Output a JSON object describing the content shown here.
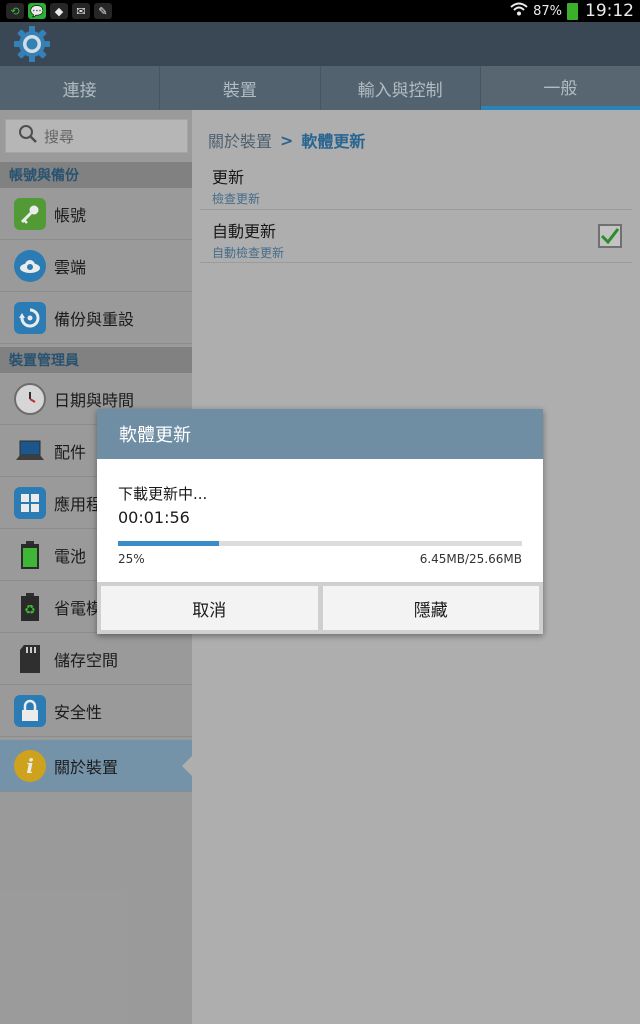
{
  "status": {
    "battery": "87%",
    "time": "19:12"
  },
  "tabs": [
    {
      "label": "連接"
    },
    {
      "label": "裝置"
    },
    {
      "label": "輸入與控制"
    },
    {
      "label": "一般",
      "active": true
    }
  ],
  "sidebar": {
    "search_placeholder": "搜尋",
    "section1": "帳號與備份",
    "section2": "裝置管理員",
    "items": [
      {
        "label": "帳號",
        "icon": "key-icon"
      },
      {
        "label": "雲端",
        "icon": "cloud-icon"
      },
      {
        "label": "備份與重設",
        "icon": "backup-icon"
      },
      {
        "label": "日期與時間",
        "icon": "clock-icon"
      },
      {
        "label": "配件",
        "icon": "laptop-icon"
      },
      {
        "label": "應用程",
        "icon": "apps-grid-icon"
      },
      {
        "label": "電池",
        "icon": "battery-icon"
      },
      {
        "label": "省電模",
        "icon": "recycle-icon"
      },
      {
        "label": "儲存空間",
        "icon": "sd-card-icon"
      },
      {
        "label": "安全性",
        "icon": "lock-icon"
      },
      {
        "label": "關於裝置",
        "icon": "info-icon",
        "active": true
      }
    ]
  },
  "breadcrumb": {
    "parent": "關於裝置",
    "separator": ">",
    "current": "軟體更新"
  },
  "settings": [
    {
      "title": "更新",
      "subtitle": "檢查更新"
    },
    {
      "title": "自動更新",
      "subtitle": "自動檢查更新",
      "checked": true
    }
  ],
  "dialog": {
    "title": "軟體更新",
    "message": "下載更新中...",
    "elapsed": "00:01:56",
    "progress": 0.25,
    "percent_label": "25%",
    "size_label": "6.45MB/25.66MB",
    "cancel_label": "取消",
    "hide_label": "隱藏"
  },
  "colors": {
    "accent": "#3a8bc6",
    "dialog_header": "#6f8ea4",
    "tab_active_underline": "#2d91c9"
  }
}
